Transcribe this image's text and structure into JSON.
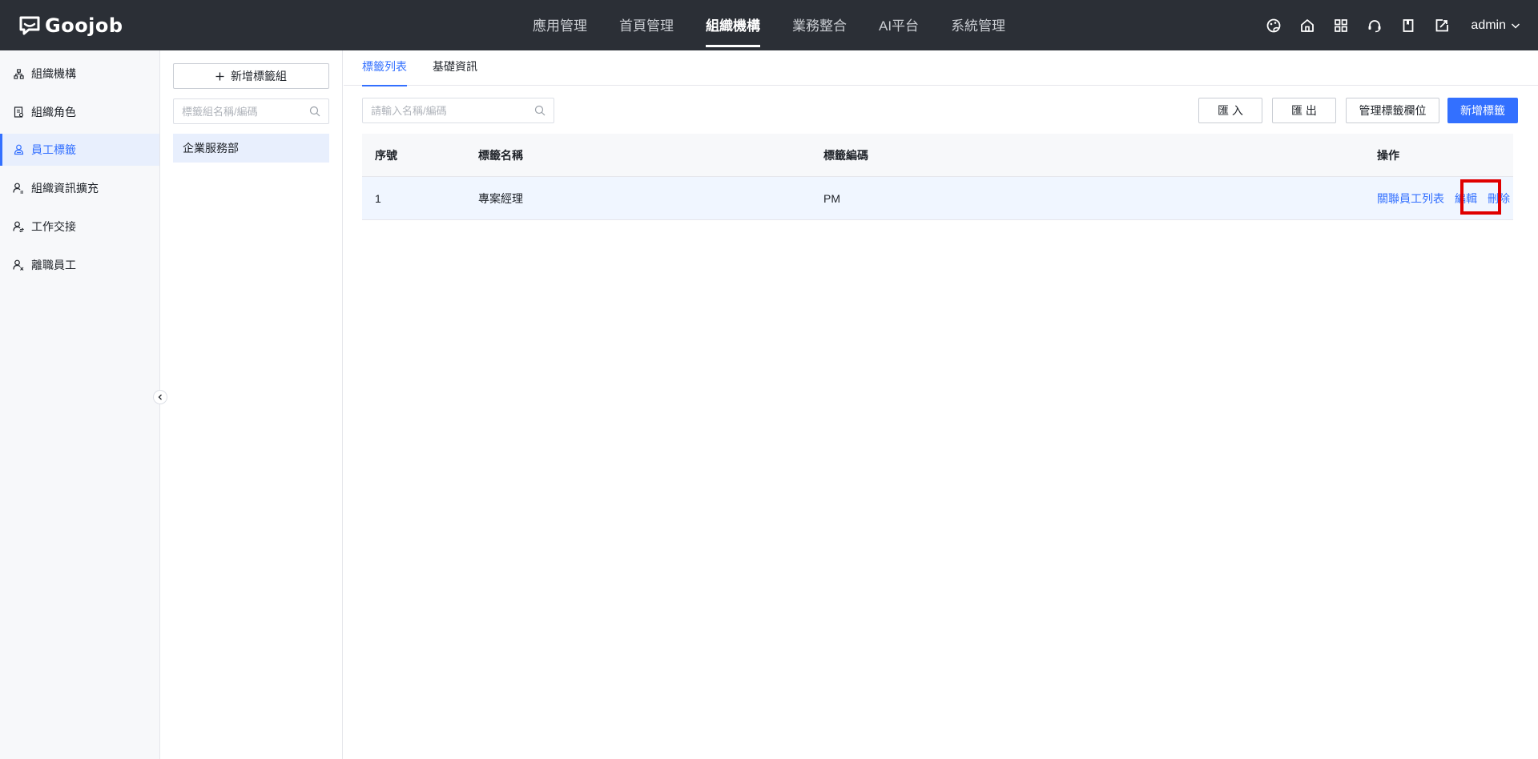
{
  "topbar": {
    "logo_text": "Goojob",
    "nav": [
      {
        "label": "應用管理"
      },
      {
        "label": "首頁管理"
      },
      {
        "label": "組織機構"
      },
      {
        "label": "業務整合"
      },
      {
        "label": "AI平台"
      },
      {
        "label": "系統管理"
      }
    ],
    "active_nav": "組織機構",
    "icons": [
      "palette-icon",
      "home-icon",
      "apps-grid-icon",
      "support-headset-icon",
      "book-icon",
      "export-icon"
    ],
    "user": "admin"
  },
  "sidebar": {
    "items": [
      {
        "label": "組織機構",
        "icon": "org-tree-icon"
      },
      {
        "label": "組織角色",
        "icon": "role-doc-icon"
      },
      {
        "label": "員工標籤",
        "icon": "user-tag-icon",
        "active": true
      },
      {
        "label": "組織資訊擴充",
        "icon": "user-extend-icon"
      },
      {
        "label": "工作交接",
        "icon": "handover-icon"
      },
      {
        "label": "離職員工",
        "icon": "user-leave-icon"
      }
    ]
  },
  "groups": {
    "add_label": "新增標籤組",
    "search_placeholder": "標籤組名稱/編碼",
    "items": [
      {
        "label": "企業服務部"
      }
    ]
  },
  "main": {
    "tabs": [
      {
        "label": "標籤列表",
        "active": true
      },
      {
        "label": "基礎資訊"
      }
    ],
    "search_placeholder": "請輸入名稱/編碼",
    "buttons": {
      "import": "匯 入",
      "export": "匯 出",
      "manage_fields": "管理標籤欄位",
      "add_tag": "新增標籤"
    },
    "table": {
      "columns": [
        "序號",
        "標籤名稱",
        "標籤編碼",
        "操作"
      ],
      "rows": [
        {
          "index": "1",
          "name": "專案經理",
          "code": "PM"
        }
      ],
      "actions": {
        "related": "關聯員工列表",
        "edit": "編輯",
        "delete": "刪除"
      }
    }
  },
  "colors": {
    "topbar_bg": "#2b2f36",
    "accent": "#3370ff",
    "highlight": "#e00000"
  }
}
